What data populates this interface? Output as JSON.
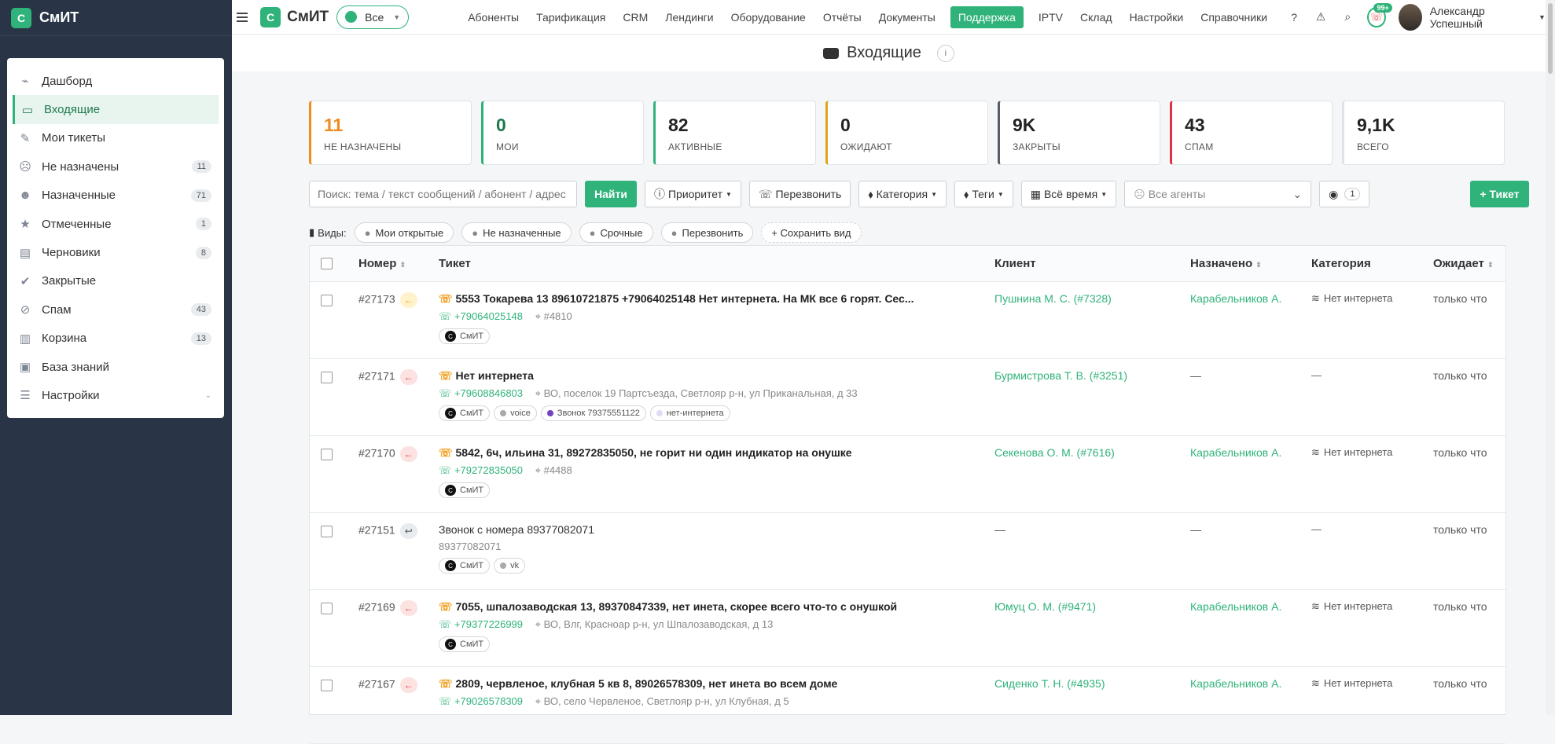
{
  "sidebar": {
    "logo_letter": "С",
    "brand": "СмИТ",
    "items": [
      {
        "label": "Дашборд",
        "icon": "chart-icon",
        "count": "",
        "active": false
      },
      {
        "label": "Входящие",
        "icon": "inbox-icon",
        "count": "",
        "active": true
      },
      {
        "label": "Мои тикеты",
        "icon": "user-edit-icon",
        "count": "",
        "active": false
      },
      {
        "label": "Не назначены",
        "icon": "user-slash-icon",
        "count": "11",
        "active": false
      },
      {
        "label": "Назначенные",
        "icon": "users-icon",
        "count": "71",
        "active": false
      },
      {
        "label": "Отмеченные",
        "icon": "star-icon",
        "count": "1",
        "active": false
      },
      {
        "label": "Черновики",
        "icon": "file-icon",
        "count": "8",
        "active": false
      },
      {
        "label": "Закрытые",
        "icon": "check-circle-icon",
        "count": "",
        "active": false
      },
      {
        "label": "Спам",
        "icon": "ban-icon",
        "count": "43",
        "active": false
      },
      {
        "label": "Корзина",
        "icon": "trash-icon",
        "count": "13",
        "active": false
      },
      {
        "label": "База знаний",
        "icon": "book-icon",
        "count": "",
        "active": false
      },
      {
        "label": "Настройки",
        "icon": "sliders-icon",
        "count": "",
        "active": false,
        "chevron": "⌄"
      }
    ]
  },
  "topbar": {
    "logo_letter": "С",
    "brand": "СмИТ",
    "selector": "Все",
    "nav": [
      "Абоненты",
      "Тарификация",
      "CRM",
      "Лендинги",
      "Оборудование",
      "Отчёты",
      "Документы",
      "Поддержка",
      "IPTV",
      "Склад",
      "Настройки",
      "Справочники"
    ],
    "active_nav": "Поддержка",
    "notif_badge": "99+",
    "user_name": "Александр Успешный"
  },
  "page": {
    "title": "Входящие",
    "info": "i"
  },
  "stats": [
    {
      "num": "11",
      "label": "НЕ НАЗНАЧЕНЫ",
      "color": "#f08c1e",
      "num_color": "#f08c1e"
    },
    {
      "num": "0",
      "label": "МОИ",
      "color": "#2fb37a",
      "num_color": "#1e7a4f"
    },
    {
      "num": "82",
      "label": "АКТИВНЫЕ",
      "color": "#2fb37a",
      "num_color": "#222"
    },
    {
      "num": "0",
      "label": "ОЖИДАЮТ",
      "color": "#e3a21a",
      "num_color": "#222"
    },
    {
      "num": "9K",
      "label": "ЗАКРЫТЫ",
      "color": "#555d66",
      "num_color": "#222"
    },
    {
      "num": "43",
      "label": "СПАМ",
      "color": "#dc3545",
      "num_color": "#222"
    },
    {
      "num": "9,1K",
      "label": "ВСЕГО",
      "color": "#dfe3e7",
      "num_color": "#222"
    }
  ],
  "filters": {
    "search_placeholder": "Поиск: тема / текст сообщений / абонент / адрес / телефон",
    "find": "Найти",
    "priority": "Приоритет",
    "callback": "Перезвонить",
    "category": "Категория",
    "tags": "Теги",
    "time": "Всё время",
    "agents": "Все агенты",
    "watch_count": "1",
    "new_ticket": "+ Тикет"
  },
  "views": {
    "label": "Виды:",
    "items": [
      "Мои открытые",
      "Не назначенные",
      "Срочные",
      "Перезвонить"
    ],
    "save": "+ Сохранить вид"
  },
  "table": {
    "headers": {
      "num": "Номер",
      "ticket": "Тикет",
      "client": "Клиент",
      "assigned": "Назначено",
      "category": "Категория",
      "waiting": "Ожидает"
    },
    "rows": [
      {
        "num": "#27173",
        "dir": "←",
        "dir_bg": "#fff3cd",
        "dir_color": "#e0a000",
        "subject": "5553 Токарева 13 89610721875 +79064025148 Нет интернета. На МК все 6 горят. Сес...",
        "bold": true,
        "phone": "+79064025148",
        "addr": "#4810",
        "tags": [
          {
            "text": "СмИТ",
            "type": "brand"
          }
        ],
        "client": "Пушнина М. С. (#7328)",
        "assigned": "Карабельников А.",
        "category": "Нет интернета",
        "waiting": "только что",
        "h": 98
      },
      {
        "num": "#27171",
        "dir": "←",
        "dir_bg": "#fde2e2",
        "dir_color": "#dc3545",
        "subject": "Нет интернета",
        "bold": true,
        "phone": "+79608846803",
        "addr": "ВО, поселок 19 Партсъезда, Светлояр р-н, ул Приканальная, д 33",
        "tags": [
          {
            "text": "СмИТ",
            "type": "brand"
          },
          {
            "text": "voice",
            "type": "dot",
            "color": "#aaa"
          },
          {
            "text": "Звонок 79375551122",
            "type": "dot",
            "color": "#6f42c1"
          },
          {
            "text": "нет-интернета",
            "type": "dot",
            "color": "#e0dcf5"
          }
        ],
        "client": "Бурмистрова Т. В. (#3251)",
        "assigned": "—",
        "category": "—",
        "waiting": "только что",
        "h": 98
      },
      {
        "num": "#27170",
        "dir": "←",
        "dir_bg": "#fde2e2",
        "dir_color": "#dc3545",
        "subject": "5842, 6ч, ильина 31, 89272835050, не горит ни один индикатор на онушке",
        "bold": true,
        "phone": "+79272835050",
        "addr": "#4488",
        "tags": [
          {
            "text": "СмИТ",
            "type": "brand"
          }
        ],
        "client": "Секенова О. М. (#7616)",
        "assigned": "Карабельников А.",
        "category": "Нет интернета",
        "waiting": "только что",
        "h": 98
      },
      {
        "num": "#27151",
        "dir": "↩",
        "dir_bg": "#e9ecef",
        "dir_color": "#556",
        "subject": "Звонок с номера 89377082071",
        "bold": false,
        "phone": "",
        "line2": "89377082071",
        "addr": "",
        "tags": [
          {
            "text": "СмИТ",
            "type": "brand"
          },
          {
            "text": "vk",
            "type": "dot",
            "color": "#aaa"
          }
        ],
        "client": "—",
        "assigned": "—",
        "category": "—",
        "waiting": "только что",
        "h": 98
      },
      {
        "num": "#27169",
        "dir": "←",
        "dir_bg": "#fde2e2",
        "dir_color": "#dc3545",
        "subject": "7055, шпалозаводская 13, 89370847339, нет инета, скорее всего что-то с онушкой",
        "bold": true,
        "phone": "+79377226999",
        "addr": "ВО, Влг, Краснoар р-н, ул Шпалозаводская, д 13",
        "tags": [
          {
            "text": "СмИТ",
            "type": "brand"
          }
        ],
        "client": "Юмуц О. М. (#9471)",
        "assigned": "Карабельников А.",
        "category": "Нет интернета",
        "waiting": "только что",
        "h": 98
      },
      {
        "num": "#27167",
        "dir": "←",
        "dir_bg": "#fde2e2",
        "dir_color": "#dc3545",
        "subject": "2809, червленое, клубная 5 кв 8, 89026578309, нет инета во всем доме",
        "bold": true,
        "phone": "+79026578309",
        "addr": "ВО, село Червленое, Светлояр р-н, ул Клубная, д 5",
        "tags": [],
        "client": "Сиденко Т. Н. (#4935)",
        "assigned": "Карабельников А.",
        "category": "Нет интернета",
        "waiting": "только что",
        "h": 98
      }
    ]
  }
}
